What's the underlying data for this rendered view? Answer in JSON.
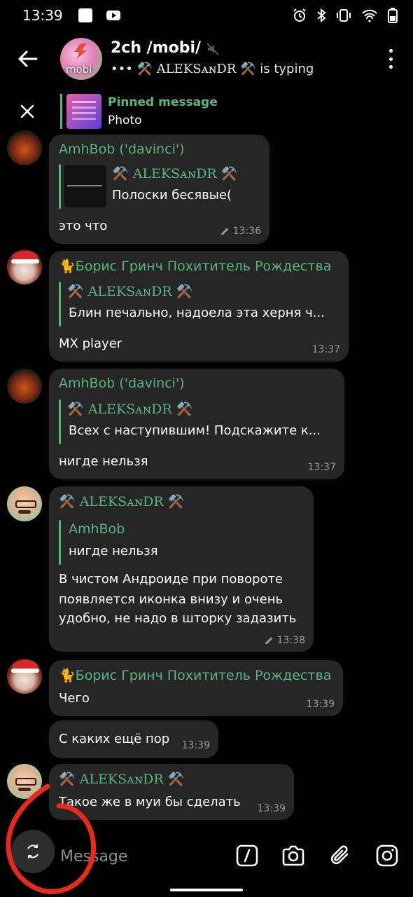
{
  "status_bar": {
    "time": "13:39",
    "right_icons": [
      "alarm-icon",
      "bluetooth-icon",
      "vibrate-icon",
      "wifi-icon",
      "battery-icon"
    ]
  },
  "header": {
    "title": "2ch /mobi/",
    "avatar_label": "mobi",
    "typing_dots": "•••",
    "typing_user": "⚒️ ALEKSᴀɴDR ⚒️",
    "typing_suffix": "is typing"
  },
  "pinned": {
    "title": "Pinned message",
    "text": "Photo"
  },
  "messages": [
    {
      "sender": "AmhBob ('davinci')",
      "reply_name": "⚒️ ALEKSᴀɴDR ⚒️",
      "reply_text": "Полоски бесявые(",
      "text": "это что",
      "time": "13:36",
      "edited": true
    },
    {
      "sender": "🐈Борис Гринч Похититель Рождества",
      "reply_name": "⚒️ ALEKSᴀɴDR ⚒️",
      "reply_text": "Блин печально, надоела эта херня ч...",
      "text": "MX player",
      "time": "13:37"
    },
    {
      "sender": "AmhBob ('davinci')",
      "reply_name": "⚒️ ALEKSᴀɴDR ⚒️",
      "reply_text": "Всех с наступившим! Подскажите к...",
      "text": "нигде нельзя",
      "time": "13:37"
    },
    {
      "sender": "⚒️ ALEKSᴀɴDR ⚒️",
      "reply_name": "AmhBob",
      "reply_text": "нигде нельзя",
      "text_lines": [
        "В чистом Андроиде при повороте",
        "появляется иконка внизу и очень",
        "удобно, не надо в шторку задазить"
      ],
      "time": "13:38",
      "edited": true
    },
    {
      "sender": "🐈Борис Гринч Похититель Рождества",
      "text": "Чего",
      "time": "13:39"
    },
    {
      "text": "С каких ещё пор",
      "time": "13:39"
    },
    {
      "sender": "⚒️ ALEKSᴀɴDR ⚒️",
      "text": "Такое же в муи бы сделать",
      "time": "13:39"
    }
  ],
  "composer": {
    "placeholder": "Message"
  },
  "colors": {
    "accent": "#5ab57f",
    "bubble": "#262626",
    "background": "#000000",
    "annotation": "#e8291c"
  }
}
